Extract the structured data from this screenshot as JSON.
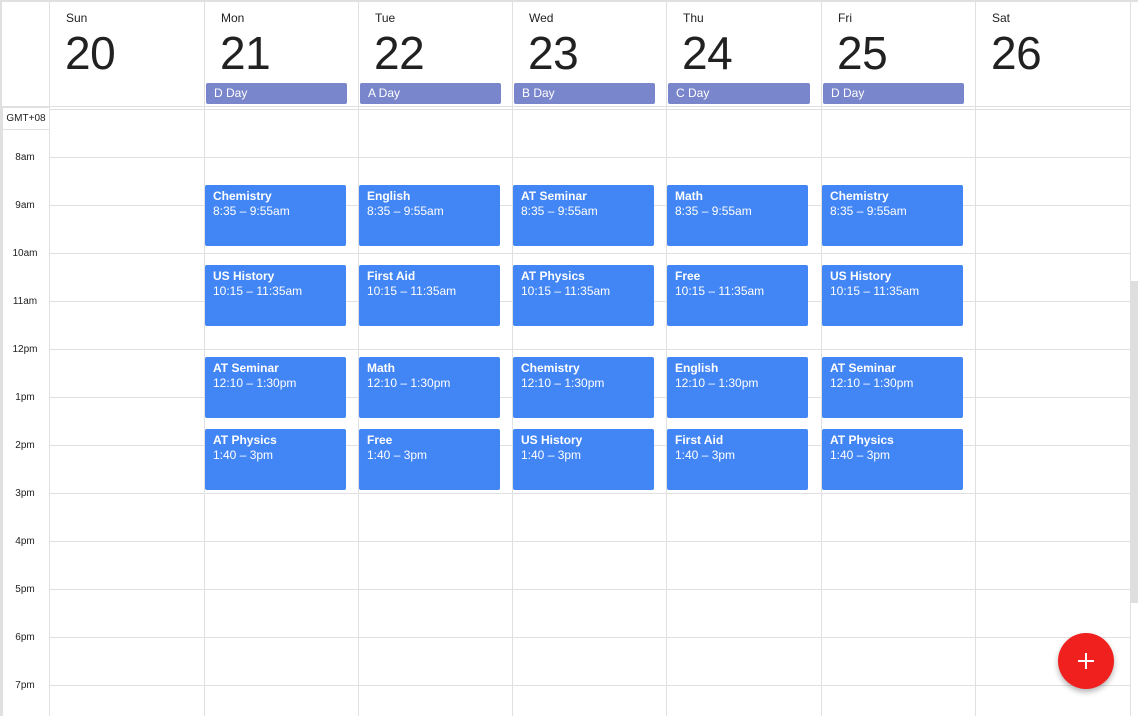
{
  "timezone_label": "GMT+08",
  "hours": [
    "8am",
    "9am",
    "10am",
    "11am",
    "12pm",
    "1pm",
    "2pm",
    "3pm",
    "4pm",
    "5pm",
    "6pm",
    "7pm"
  ],
  "days": [
    {
      "name": "Sun",
      "date": "20",
      "allday": null,
      "events": []
    },
    {
      "name": "Mon",
      "date": "21",
      "allday": "D Day",
      "events": [
        {
          "title": "Chemistry",
          "time": "8:35 – 9:55am",
          "start": 8.583,
          "end": 9.917
        },
        {
          "title": "US History",
          "time": "10:15 – 11:35am",
          "start": 10.25,
          "end": 11.583
        },
        {
          "title": "AT Seminar",
          "time": "12:10 – 1:30pm",
          "start": 12.167,
          "end": 13.5
        },
        {
          "title": "AT Physics",
          "time": "1:40 – 3pm",
          "start": 13.667,
          "end": 15.0
        }
      ]
    },
    {
      "name": "Tue",
      "date": "22",
      "allday": "A Day",
      "events": [
        {
          "title": "English",
          "time": "8:35 – 9:55am",
          "start": 8.583,
          "end": 9.917
        },
        {
          "title": "First Aid",
          "time": "10:15 – 11:35am",
          "start": 10.25,
          "end": 11.583
        },
        {
          "title": "Math",
          "time": "12:10 – 1:30pm",
          "start": 12.167,
          "end": 13.5
        },
        {
          "title": "Free",
          "time": "1:40 – 3pm",
          "start": 13.667,
          "end": 15.0
        }
      ]
    },
    {
      "name": "Wed",
      "date": "23",
      "allday": "B Day",
      "events": [
        {
          "title": "AT Seminar",
          "time": "8:35 – 9:55am",
          "start": 8.583,
          "end": 9.917
        },
        {
          "title": "AT Physics",
          "time": "10:15 – 11:35am",
          "start": 10.25,
          "end": 11.583
        },
        {
          "title": "Chemistry",
          "time": "12:10 – 1:30pm",
          "start": 12.167,
          "end": 13.5
        },
        {
          "title": "US History",
          "time": "1:40 – 3pm",
          "start": 13.667,
          "end": 15.0
        }
      ]
    },
    {
      "name": "Thu",
      "date": "24",
      "allday": "C Day",
      "events": [
        {
          "title": "Math",
          "time": "8:35 – 9:55am",
          "start": 8.583,
          "end": 9.917
        },
        {
          "title": "Free",
          "time": "10:15 – 11:35am",
          "start": 10.25,
          "end": 11.583
        },
        {
          "title": "English",
          "time": "12:10 – 1:30pm",
          "start": 12.167,
          "end": 13.5
        },
        {
          "title": "First Aid",
          "time": "1:40 – 3pm",
          "start": 13.667,
          "end": 15.0
        }
      ]
    },
    {
      "name": "Fri",
      "date": "25",
      "allday": "D Day",
      "events": [
        {
          "title": "Chemistry",
          "time": "8:35 – 9:55am",
          "start": 8.583,
          "end": 9.917
        },
        {
          "title": "US History",
          "time": "10:15 – 11:35am",
          "start": 10.25,
          "end": 11.583
        },
        {
          "title": "AT Seminar",
          "time": "12:10 – 1:30pm",
          "start": 12.167,
          "end": 13.5
        },
        {
          "title": "AT Physics",
          "time": "1:40 – 3pm",
          "start": 13.667,
          "end": 15.0
        }
      ]
    },
    {
      "name": "Sat",
      "date": "26",
      "allday": null,
      "events": []
    }
  ],
  "fab": {
    "icon": "plus-icon",
    "label": "Create event"
  },
  "colors": {
    "event": "#4285f4",
    "allday": "#7986cb",
    "fab": "#f0201e",
    "gridline": "#e0e0e0"
  }
}
